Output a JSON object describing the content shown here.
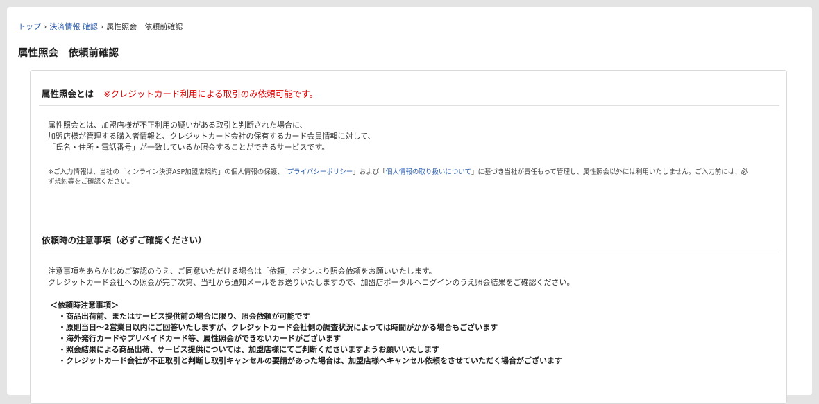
{
  "breadcrumb": {
    "top": "トップ",
    "payment": "決済情報 確認",
    "current": "属性照会　依頼前確認",
    "separator": "›"
  },
  "page_title": "属性照会　依頼前確認",
  "about": {
    "heading": "属性照会とは",
    "warning": "※クレジットカード利用による取引のみ依頼可能です。",
    "lines": [
      "属性照会とは、加盟店様が不正利用の疑いがある取引と判断された場合に、",
      "加盟店様が管理する購入者情報と、クレジットカード会社の保有するカード会員情報に対して、",
      "「氏名・住所・電話番号」が一致しているか照会することができるサービスです。"
    ],
    "note": {
      "part1": "※ご入力情報は、当社の「オンライン決済ASP加盟店規約」の個人情報の保護、「",
      "privacy_link": "プライバシーポリシー",
      "part2": "」および「",
      "personal_link": "個人情報の取り扱いについて",
      "part3": "」に基づき当社が責任もって管理し、属性照会以外には利用いたしません。ご入力前には、必ず規約等をご確認ください。"
    }
  },
  "notice": {
    "heading": "依頼時の注意事項（必ずご確認ください）",
    "lines": [
      "注意事項をあらかじめご確認のうえ、ご同意いただける場合は「依頼」ボタンより照会依頼をお願いいたします。",
      "クレジットカード会社への照会が完了次第、当社から通知メールをお送りいたしますので、加盟店ポータルへログインのうえ照会結果をご確認ください。"
    ],
    "caution_title": "＜依頼時注意事項＞",
    "items": [
      "・商品出荷前、またはサービス提供前の場合に限り、照会依頼が可能です",
      "・原則当日～2営業日以内にご回答いたしますが、クレジットカード会社側の調査状況によっては時間がかかる場合もございます",
      "・海外発行カードやプリペイドカード等、属性照会ができないカードがございます",
      "・照会結果による商品出荷、サービス提供については、加盟店様にてご判断くださいますようお願いいたします",
      "・クレジットカード会社が不正取引と判断し取引キャンセルの要請があった場合は、加盟店様へキャンセル依頼をさせていただく場合がございます"
    ]
  }
}
